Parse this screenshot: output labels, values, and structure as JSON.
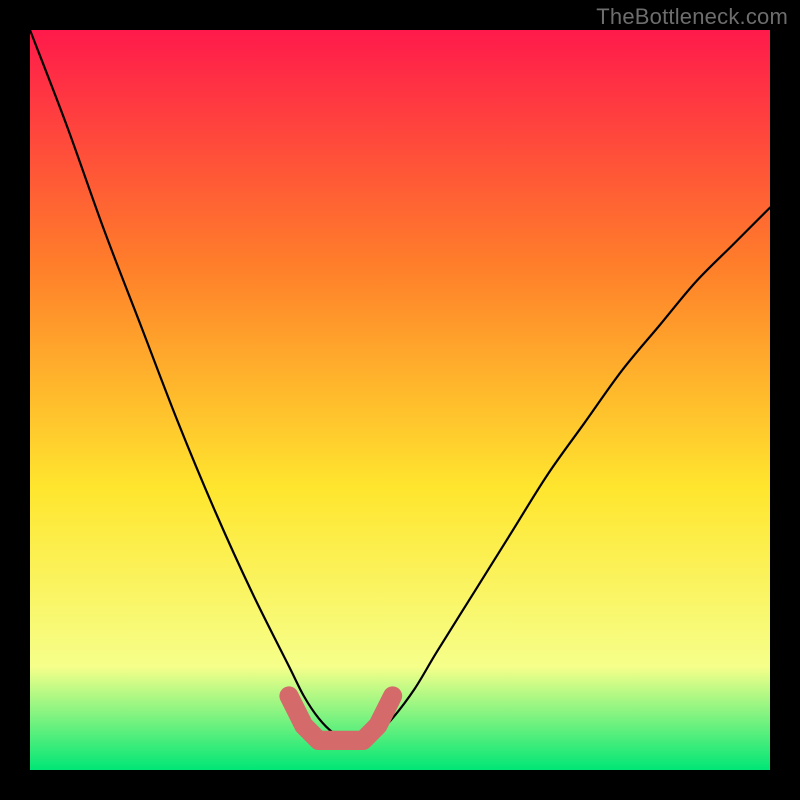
{
  "watermark": "TheBottleneck.com",
  "chart_data": {
    "type": "line",
    "title": "",
    "xlabel": "",
    "ylabel": "",
    "xlim": [
      0,
      100
    ],
    "ylim": [
      0,
      100
    ],
    "grid": false,
    "background_gradient": {
      "top_color": "#ff1a4b",
      "upper_mid_color": "#ff7f2a",
      "mid_color": "#ffe62e",
      "lower_color": "#f6ff8a",
      "bottom_color": "#00e676"
    },
    "series": [
      {
        "name": "bottleneck-curve",
        "stroke": "#000000",
        "x": [
          0,
          5,
          10,
          15,
          20,
          25,
          30,
          35,
          37,
          39,
          41,
          43,
          45,
          47,
          49,
          52,
          55,
          60,
          65,
          70,
          75,
          80,
          85,
          90,
          95,
          100
        ],
        "y": [
          100,
          87,
          73,
          60,
          47,
          35,
          24,
          14,
          10,
          7,
          5,
          4,
          4,
          5,
          7,
          11,
          16,
          24,
          32,
          40,
          47,
          54,
          60,
          66,
          71,
          76
        ]
      },
      {
        "name": "sweet-spot-marker",
        "stroke": "#d46a6a",
        "stroke_width": 12,
        "x": [
          35,
          37,
          39,
          41,
          43,
          45,
          47,
          49
        ],
        "y": [
          10,
          6,
          4,
          4,
          4,
          4,
          6,
          10
        ]
      }
    ],
    "annotations": []
  }
}
